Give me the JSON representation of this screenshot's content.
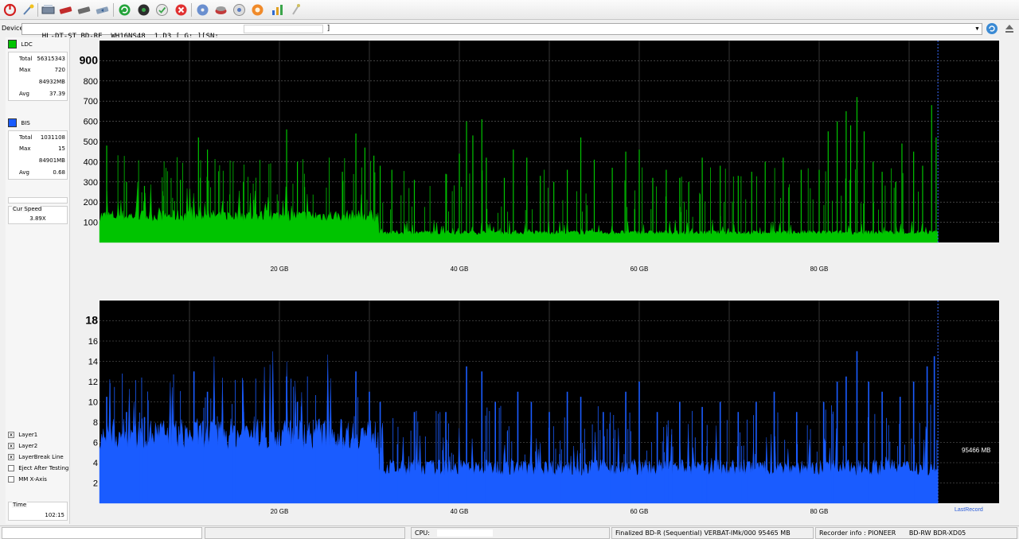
{
  "toolbar": {
    "buttons": [
      "power-icon",
      "wand-icon",
      "drive-info-icon",
      "erase-disc-icon",
      "burn-disc-icon",
      "copy-disc-icon",
      "refresh-icon",
      "scan-icon",
      "test-icon",
      "stop-icon",
      "disc-icon",
      "save-icon",
      "print-icon",
      "settings-icon",
      "chart-icon",
      "tools-icon"
    ]
  },
  "device": {
    "label": "Device:",
    "value": "HL-DT-ST BD-RE  WH16NS48  1.D3 [ G: ][SN:",
    "suffix": "]"
  },
  "ldc": {
    "legend": "LDC",
    "color": "#00c400",
    "total_label": "Total",
    "total": "56315343",
    "max_label": "Max",
    "max": "720",
    "max_pos": "84932MB",
    "avg_label": "Avg",
    "avg": "37.39"
  },
  "bis": {
    "legend": "BIS",
    "color": "#1a5cff",
    "total_label": "Total",
    "total": "1031108",
    "max_label": "Max",
    "max": "15",
    "max_pos": "84901MB",
    "avg_label": "Avg",
    "avg": "0.68"
  },
  "speed": {
    "label": "Cur Speed",
    "value": "3.89X"
  },
  "options": [
    {
      "label": "Layer1",
      "checked": true,
      "mark": "x"
    },
    {
      "label": "Layer2",
      "checked": true,
      "mark": "x"
    },
    {
      "label": "LayerBreak Line",
      "checked": true,
      "mark": "x"
    },
    {
      "label": "Eject After Testing",
      "checked": false,
      "mark": ""
    },
    {
      "label": "MM X-Axis",
      "checked": false,
      "mark": ""
    }
  ],
  "time": {
    "label": "Time",
    "value": "102:15"
  },
  "chart_data": [
    {
      "type": "line",
      "name": "LDC",
      "color": "#00c400",
      "x_tick_labels": [
        "20 GB",
        "40 GB",
        "60 GB",
        "80 GB"
      ],
      "x_ticks_gb": [
        20,
        40,
        60,
        80
      ],
      "xlim_gb": [
        0,
        100
      ],
      "data_end_gb": 93.2,
      "y_ticks": [
        "900",
        "800",
        "700",
        "600",
        "500",
        "400",
        "300",
        "200",
        "100"
      ],
      "ylim": [
        0,
        1000
      ],
      "grid": true,
      "baseline_segments": [
        {
          "from_gb": 0,
          "to_gb": 31,
          "level": 120
        },
        {
          "from_gb": 31,
          "to_gb": 93.2,
          "level": 45
        }
      ],
      "peaks": [
        [
          0.8,
          480
        ],
        [
          3,
          300
        ],
        [
          5,
          280
        ],
        [
          9,
          310
        ],
        [
          11,
          520
        ],
        [
          12,
          460
        ],
        [
          16,
          300
        ],
        [
          20.8,
          560
        ],
        [
          22,
          400
        ],
        [
          27,
          350
        ],
        [
          28.5,
          540
        ],
        [
          29.5,
          470
        ],
        [
          30.5,
          430
        ],
        [
          31.2,
          380
        ],
        [
          32.5,
          360
        ],
        [
          35,
          310
        ],
        [
          38.5,
          340
        ],
        [
          40,
          440
        ],
        [
          40.8,
          600
        ],
        [
          41.5,
          530
        ],
        [
          42.5,
          610
        ],
        [
          43,
          420
        ],
        [
          45,
          320
        ],
        [
          46,
          460
        ],
        [
          47.5,
          420
        ],
        [
          49,
          330
        ],
        [
          50.5,
          300
        ],
        [
          52,
          360
        ],
        [
          53.5,
          520
        ],
        [
          55,
          410
        ],
        [
          57,
          370
        ],
        [
          58.5,
          450
        ],
        [
          60,
          460
        ],
        [
          61.5,
          320
        ],
        [
          63,
          360
        ],
        [
          64.5,
          320
        ],
        [
          65.5,
          300
        ],
        [
          67,
          420
        ],
        [
          69,
          380
        ],
        [
          71,
          330
        ],
        [
          72.5,
          350
        ],
        [
          74,
          400
        ],
        [
          76,
          420
        ],
        [
          78,
          360
        ],
        [
          80,
          360
        ],
        [
          81,
          550
        ],
        [
          82,
          600
        ],
        [
          83,
          650
        ],
        [
          83.5,
          580
        ],
        [
          84.2,
          720
        ],
        [
          85,
          550
        ],
        [
          86,
          400
        ],
        [
          87,
          350
        ],
        [
          88.5,
          300
        ],
        [
          89.2,
          490
        ],
        [
          90.5,
          450
        ],
        [
          91.5,
          380
        ],
        [
          92.5,
          680
        ],
        [
          93,
          520
        ]
      ]
    },
    {
      "type": "bar",
      "name": "BIS",
      "color": "#1a5cff",
      "x_tick_labels": [
        "20 GB",
        "40 GB",
        "60 GB",
        "80 GB"
      ],
      "x_ticks_gb": [
        20,
        40,
        60,
        80
      ],
      "xlim_gb": [
        0,
        100
      ],
      "data_end_gb": 93.2,
      "y_ticks": [
        "18",
        "16",
        "14",
        "12",
        "10",
        "8",
        "6",
        "4",
        "2"
      ],
      "ylim": [
        0,
        20
      ],
      "grid": true,
      "baseline_segments": [
        {
          "from_gb": 0,
          "to_gb": 31,
          "level": 6.2
        },
        {
          "from_gb": 31,
          "to_gb": 93.2,
          "level": 3.2
        }
      ],
      "peaks": [
        [
          0.8,
          10.5
        ],
        [
          3,
          9
        ],
        [
          5,
          8.5
        ],
        [
          10.5,
          13
        ],
        [
          12,
          11
        ],
        [
          16,
          9
        ],
        [
          20.8,
          12.5
        ],
        [
          22,
          10
        ],
        [
          28.5,
          13
        ],
        [
          30,
          11
        ],
        [
          31.2,
          10
        ],
        [
          35,
          9
        ],
        [
          38.5,
          9
        ],
        [
          40.8,
          13.5
        ],
        [
          42.5,
          13
        ],
        [
          44,
          10
        ],
        [
          46.5,
          11
        ],
        [
          48,
          10
        ],
        [
          50,
          9
        ],
        [
          52,
          11
        ],
        [
          53.5,
          10.5
        ],
        [
          56,
          9
        ],
        [
          58.5,
          11
        ],
        [
          60,
          12
        ],
        [
          62,
          9
        ],
        [
          64.5,
          10
        ],
        [
          67,
          9.5
        ],
        [
          69,
          10
        ],
        [
          71,
          9
        ],
        [
          73,
          10
        ],
        [
          75,
          11
        ],
        [
          77.5,
          9
        ],
        [
          80.5,
          10
        ],
        [
          82,
          12
        ],
        [
          83,
          12.5
        ],
        [
          84.2,
          15
        ],
        [
          85.5,
          12
        ],
        [
          87,
          11
        ],
        [
          89,
          10.5
        ],
        [
          90.5,
          12
        ],
        [
          92,
          13.5
        ],
        [
          92.8,
          14.5
        ]
      ],
      "annotations": [
        "95466 MB",
        "LastRecord"
      ]
    }
  ],
  "status": {
    "cpu_label": "CPU:",
    "disc_info": "Finalized  BD-R (Sequential)  VERBAT-IMk/000  95465 MB",
    "recorder_label": "Recorder info : PIONEER",
    "recorder_model": "BD-RW  BDR-XD05"
  }
}
